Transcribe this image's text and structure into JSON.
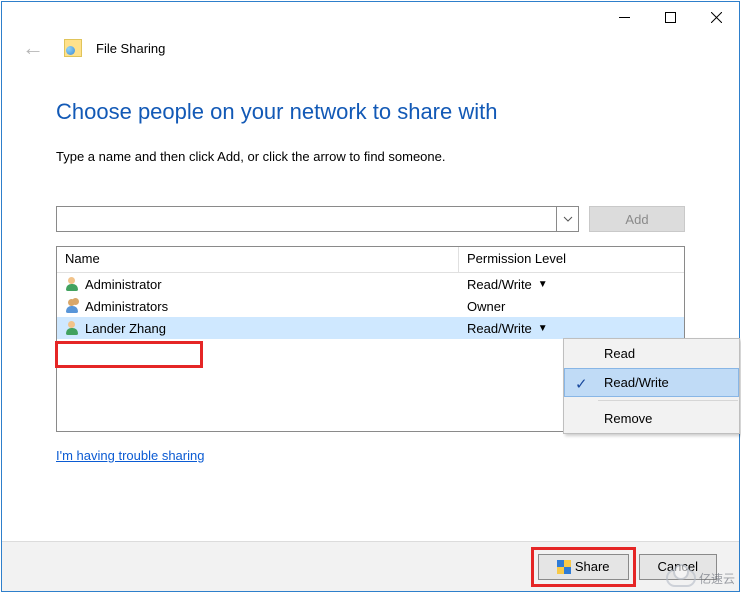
{
  "header": {
    "title": "File Sharing"
  },
  "main": {
    "heading": "Choose people on your network to share with",
    "subtext": "Type a name and then click Add, or click the arrow to find someone.",
    "add_label": "Add",
    "input_value": ""
  },
  "table": {
    "col_name": "Name",
    "col_perm": "Permission Level",
    "rows": [
      {
        "name": "Administrator",
        "perm": "Read/Write",
        "has_drop": true,
        "group": false,
        "selected": false
      },
      {
        "name": "Administrators",
        "perm": "Owner",
        "has_drop": false,
        "group": true,
        "selected": false
      },
      {
        "name": "Lander Zhang",
        "perm": "Read/Write",
        "has_drop": true,
        "group": false,
        "selected": true
      }
    ]
  },
  "menu": {
    "items": [
      "Read",
      "Read/Write",
      "Remove"
    ],
    "checked_index": 1
  },
  "help_link": "I'm having trouble sharing",
  "footer": {
    "share": "Share",
    "cancel": "Cancel"
  },
  "watermark": "亿速云"
}
